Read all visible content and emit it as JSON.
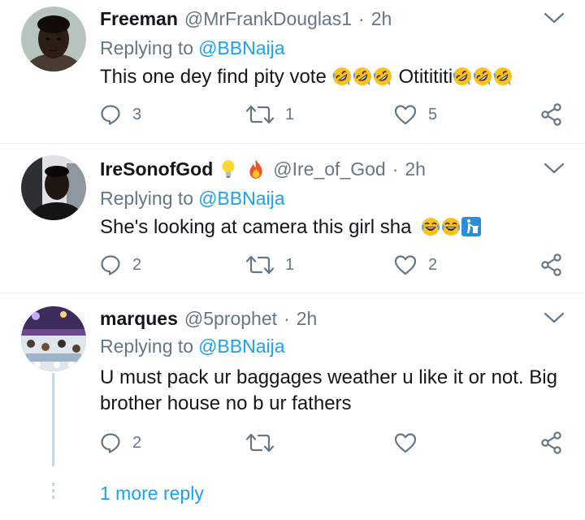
{
  "colors": {
    "accent": "#1da1f2",
    "secondary_text": "#657786",
    "primary_text": "#14171a",
    "divider": "#e6ecf0"
  },
  "tweets": [
    {
      "name": "Freeman",
      "handle": "@MrFrankDouglas1",
      "separator": "·",
      "time": "2h",
      "replying_label": "Replying to",
      "replying_to": "@BBNaija",
      "text_parts": [
        "This one dey find pity vote ",
        "Otitititi"
      ],
      "emoji": [
        "rolling-on-floor-laughing",
        "rolling-on-floor-laughing",
        "rolling-on-floor-laughing",
        "rolling-on-floor-laughing",
        "rolling-on-floor-laughing",
        "rolling-on-floor-laughing"
      ],
      "replies": "3",
      "retweets": "1",
      "likes": "5"
    },
    {
      "name": "IreSonofGod",
      "name_emoji": [
        "light-bulb",
        "fire"
      ],
      "handle": "@Ire_of_God",
      "separator": "·",
      "time": "2h",
      "replying_label": "Replying to",
      "replying_to": "@BBNaija",
      "text": "She's looking at camera this girl sha",
      "emoji": [
        "face-with-tears-of-joy",
        "face-with-tears-of-joy",
        "put-litter-in-its-place"
      ],
      "replies": "2",
      "retweets": "1",
      "likes": "2"
    },
    {
      "name": "marques",
      "handle": "@5prophet",
      "separator": "·",
      "time": "2h",
      "replying_label": "Replying to",
      "replying_to": "@BBNaija",
      "text": "U must pack ur baggages weather u like it or not. Big brother house no b ur fathers",
      "replies": "2",
      "retweets": "",
      "likes": ""
    }
  ],
  "more_replies": "1 more reply",
  "icons": [
    "reply-icon",
    "retweet-icon",
    "like-icon",
    "share-icon",
    "chevron-down-icon"
  ]
}
